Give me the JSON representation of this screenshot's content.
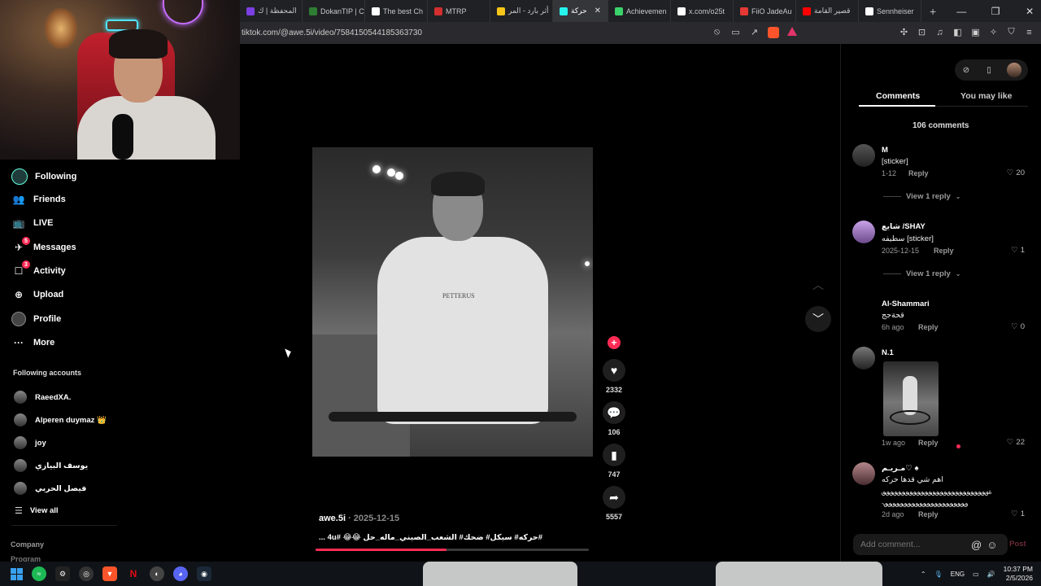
{
  "browser": {
    "tabs": [
      {
        "label": "المحفظة | ك",
        "color": "#7b3fe4"
      },
      {
        "label": "DokanTIP | C",
        "color": "#2e7d32"
      },
      {
        "label": "The best Ch",
        "color": "#ffffff"
      },
      {
        "label": "MTRP",
        "color": "#d32f2f"
      },
      {
        "label": "أثر بارد - المر",
        "color": "#f5c518"
      },
      {
        "label": "حركة",
        "color": "#25f4ee",
        "active": true
      },
      {
        "label": "Achievemen",
        "color": "#3bd36b"
      },
      {
        "label": "x.com/o25t",
        "color": "#ffffff"
      },
      {
        "label": "FiiO JadeAu",
        "color": "#e53935"
      },
      {
        "label": "قصير القامة",
        "color": "#ff0000"
      },
      {
        "label": "Sennheiser",
        "color": "#ffffff"
      }
    ],
    "new_tab": "+",
    "url": "tiktok.com/@awe.5i/video/7584150544185363730"
  },
  "sidebar": {
    "items": [
      {
        "label": "Following",
        "icon": "avatar-icon"
      },
      {
        "label": "Friends",
        "icon": "friends-icon"
      },
      {
        "label": "LIVE",
        "icon": "live-icon"
      },
      {
        "label": "Messages",
        "icon": "messages-icon",
        "badge": "5"
      },
      {
        "label": "Activity",
        "icon": "activity-icon",
        "badge": "3"
      },
      {
        "label": "Upload",
        "icon": "upload-icon"
      },
      {
        "label": "Profile",
        "icon": "profile-avatar-icon"
      },
      {
        "label": "More",
        "icon": "more-icon"
      }
    ],
    "following_title": "Following accounts",
    "accounts": [
      {
        "name": "RaeedXA."
      },
      {
        "name": "Alperen duymaz 👑"
      },
      {
        "name": "joy"
      },
      {
        "name": "يوسف البيازي"
      },
      {
        "name": "فيصل الحربي"
      }
    ],
    "view_all": "View all",
    "company": "Company",
    "program": "Program"
  },
  "video": {
    "shirt_text": "PETTERUS",
    "author": "awe.5i",
    "date": " · 2025-12-15",
    "caption": "#حركه# سيكل# ضحك# الشعب_الصيني_ماله_حل 😂😂 #4u ...",
    "progress": 0.48,
    "likes": "2332",
    "comments": "106",
    "saves": "747",
    "shares": "5557"
  },
  "comments_panel": {
    "tab_comments": "Comments",
    "tab_you_may_like": "You may like",
    "count_label": "106 comments",
    "comments": [
      {
        "name": "M",
        "text": "[sticker]",
        "meta": "1-12",
        "reply": "Reply",
        "likes": "20",
        "view_replies": "View 1 reply"
      },
      {
        "name": "شايع /SHAY",
        "text": "سطيفه [sticker]",
        "meta": "2025-12-15",
        "reply": "Reply",
        "likes": "1",
        "view_replies": "View 1 reply"
      },
      {
        "name": "Al-Shammari",
        "text": "قحةجج",
        "meta": "6h ago",
        "reply": "Reply",
        "likes": "0"
      },
      {
        "name": "N.1",
        "text": "",
        "meta": "1w ago",
        "reply": "Reply",
        "likes": "22"
      },
      {
        "name": "مـريـم♡ ♠",
        "text": "اهم شي قدها حركه",
        "text2": "ة؈؈؈؈؈؈؈؈؈؈؈؈؈؈؈؈؈؈؈؈؈؈؈؈؈؈؈؈",
        "text3": "-؈؈؈؈؈؈؈؈؈؈؈؈؈؈؈؈؈؈؈؈؈؈",
        "meta": "2d ago",
        "reply": "Reply",
        "likes": "1"
      }
    ],
    "add_placeholder": "Add comment...",
    "post": "Post"
  },
  "taskbar": {
    "lang": "ENG",
    "time": "10:37 PM",
    "date": "2/5/2026"
  }
}
